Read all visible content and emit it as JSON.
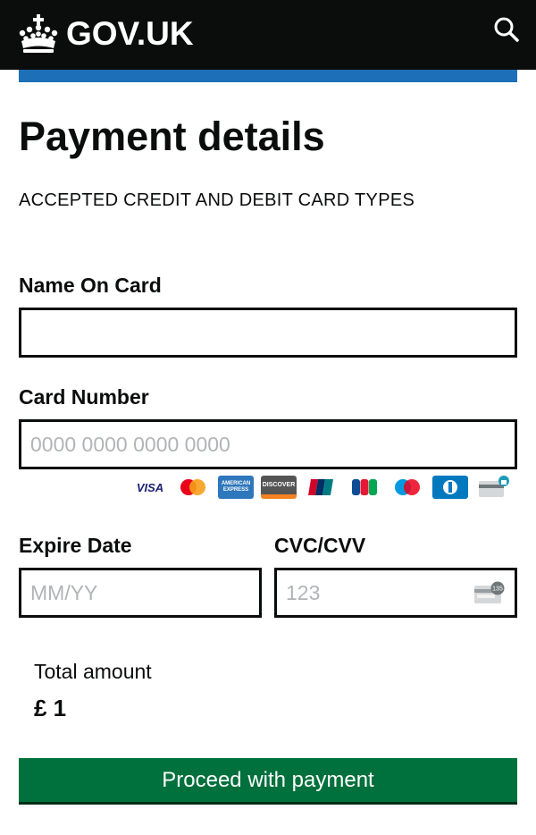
{
  "header": {
    "logo_text": "GOV.UK",
    "search_icon": "search-icon",
    "background": "#0b0c0c",
    "accent_bar": "#1d70b8"
  },
  "page": {
    "title": "Payment details",
    "card_types_heading": "ACCEPTED CREDIT AND DEBIT CARD TYPES"
  },
  "form": {
    "name_label": "Name On Card",
    "name_value": "",
    "card_number_label": "Card Number",
    "card_number_placeholder": "0000 0000 0000 0000",
    "expiry_label": "Expire Date",
    "expiry_placeholder": "MM/YY",
    "cvc_label": "CVC/CVV",
    "cvc_placeholder": "123",
    "cvc_icon_text": "135"
  },
  "card_brands": [
    {
      "name": "VISA",
      "icon": "visa-icon"
    },
    {
      "name": "MasterCard",
      "icon": "mastercard-icon"
    },
    {
      "name": "AMERICAN EXPRESS",
      "icon": "amex-icon"
    },
    {
      "name": "DISCOVER",
      "icon": "discover-icon"
    },
    {
      "name": "UnionPay",
      "icon": "unionpay-icon"
    },
    {
      "name": "JCB",
      "icon": "jcb-icon"
    },
    {
      "name": "Maestro",
      "icon": "maestro-icon"
    },
    {
      "name": "Diners Club",
      "icon": "diners-icon"
    },
    {
      "name": "Secure card",
      "icon": "secure-card-icon"
    }
  ],
  "summary": {
    "total_label": "Total amount",
    "total_value": "£ 1"
  },
  "actions": {
    "proceed_label": "Proceed with payment",
    "proceed_color": "#00703c"
  }
}
